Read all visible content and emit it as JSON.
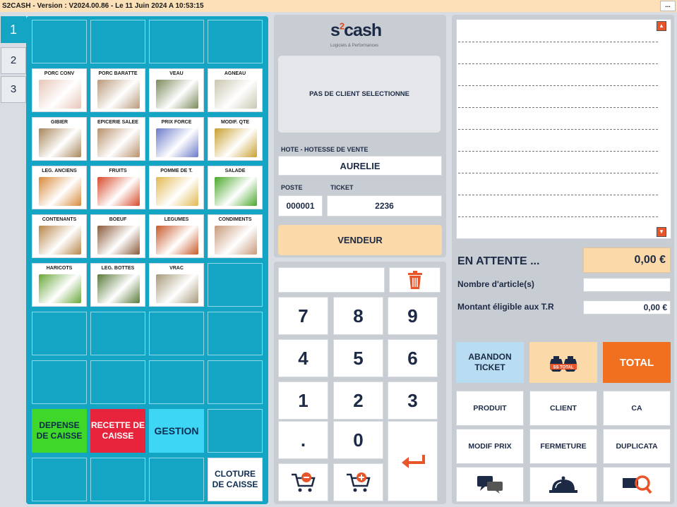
{
  "window": {
    "title": "S2CASH - Version : V2024.00.86 - Le 11 Juin 2024 A 10:53:15",
    "menu_button": "..."
  },
  "tabs": [
    "1",
    "2",
    "3"
  ],
  "products": [
    {
      "label": "PORC CONV",
      "image": "piglets-photo",
      "color": "#e8c6b8"
    },
    {
      "label": "PORC BARATTE",
      "image": "pigs-photo",
      "color": "#b89a7a"
    },
    {
      "label": "VEAU",
      "image": "calf-photo",
      "color": "#7a8a5a"
    },
    {
      "label": "AGNEAU",
      "image": "lamb-photo",
      "color": "#c9c6b0"
    },
    {
      "label": "GIBIER",
      "image": "pheasant-rabbit-photo",
      "color": "#a8865a"
    },
    {
      "label": "EPICERIE SALEE",
      "image": "grocery-photo",
      "color": "#b8906a"
    },
    {
      "label": "PRIX FORCE",
      "image": "price-tag-photo",
      "color": "#6a7ac8"
    },
    {
      "label": "MODIF. QTE",
      "image": "coins-photo",
      "color": "#c8a030"
    },
    {
      "label": "LEG. ANCIENS",
      "image": "squash-photo",
      "color": "#d88a3a"
    },
    {
      "label": "FRUITS",
      "image": "fruits-photo",
      "color": "#d84a2a"
    },
    {
      "label": "POMME DE T.",
      "image": "potatoes-photo",
      "color": "#e2b850"
    },
    {
      "label": "SALADE",
      "image": "lettuce-photo",
      "color": "#4aa82a"
    },
    {
      "label": "CONTENANTS",
      "image": "basket-photo",
      "color": "#b8864a"
    },
    {
      "label": "BOEUF",
      "image": "cow-photo",
      "color": "#8a5a3a"
    },
    {
      "label": "LEGUMES",
      "image": "vegetables-photo",
      "color": "#c85a2a"
    },
    {
      "label": "CONDIMENTS",
      "image": "onions-photo",
      "color": "#c89a7a"
    },
    {
      "label": "HARICOTS",
      "image": "green-beans-photo",
      "color": "#6aa83a"
    },
    {
      "label": "LEG. BOTTES",
      "image": "bunched-veg-photo",
      "color": "#5a7a3a"
    },
    {
      "label": "VRAC",
      "image": "bulk-jars-photo",
      "color": "#a89a7a"
    }
  ],
  "actions": {
    "depense": "DEPENSE DE CAISSE",
    "recette": "RECETTE DE CAISSE",
    "gestion": "GESTION",
    "cloture": "CLOTURE DE CAISSE"
  },
  "logo": {
    "text": "s2cash",
    "sub": "Logiciels & Performances"
  },
  "client": {
    "status": "PAS DE CLIENT SELECTIONNE"
  },
  "host": {
    "label": "HOTE - HOTESSE DE VENTE",
    "value": "AURELIE"
  },
  "poste": {
    "label": "POSTE",
    "value": "000001"
  },
  "ticket": {
    "label": "TICKET",
    "value": "2236"
  },
  "vendeur": "VENDEUR",
  "keypad": [
    "7",
    "8",
    "9",
    "4",
    "5",
    "6",
    "1",
    "2",
    "3",
    ".",
    "0"
  ],
  "summary": {
    "attente_label": "EN ATTENTE ...",
    "attente_value": "0,00 €",
    "articles_label": "Nombre d'article(s)",
    "articles_value": "",
    "tr_label": "Montant éligible aux T.R",
    "tr_value": "0,00 €"
  },
  "buttons": {
    "abandon": "ABANDON TICKET",
    "sstotal": "SS TOTAL",
    "total": "TOTAL",
    "produit": "PRODUIT",
    "client": "CLIENT",
    "ca": "CA",
    "modif_prix": "MODIF PRIX",
    "fermeture": "FERMETURE",
    "duplicata": "DUPLICATA"
  },
  "colors": {
    "accent": "#14a5c4",
    "orange": "#f07020",
    "peach": "#fcd9a9",
    "green": "#3fd82a",
    "red": "#e8243c"
  }
}
